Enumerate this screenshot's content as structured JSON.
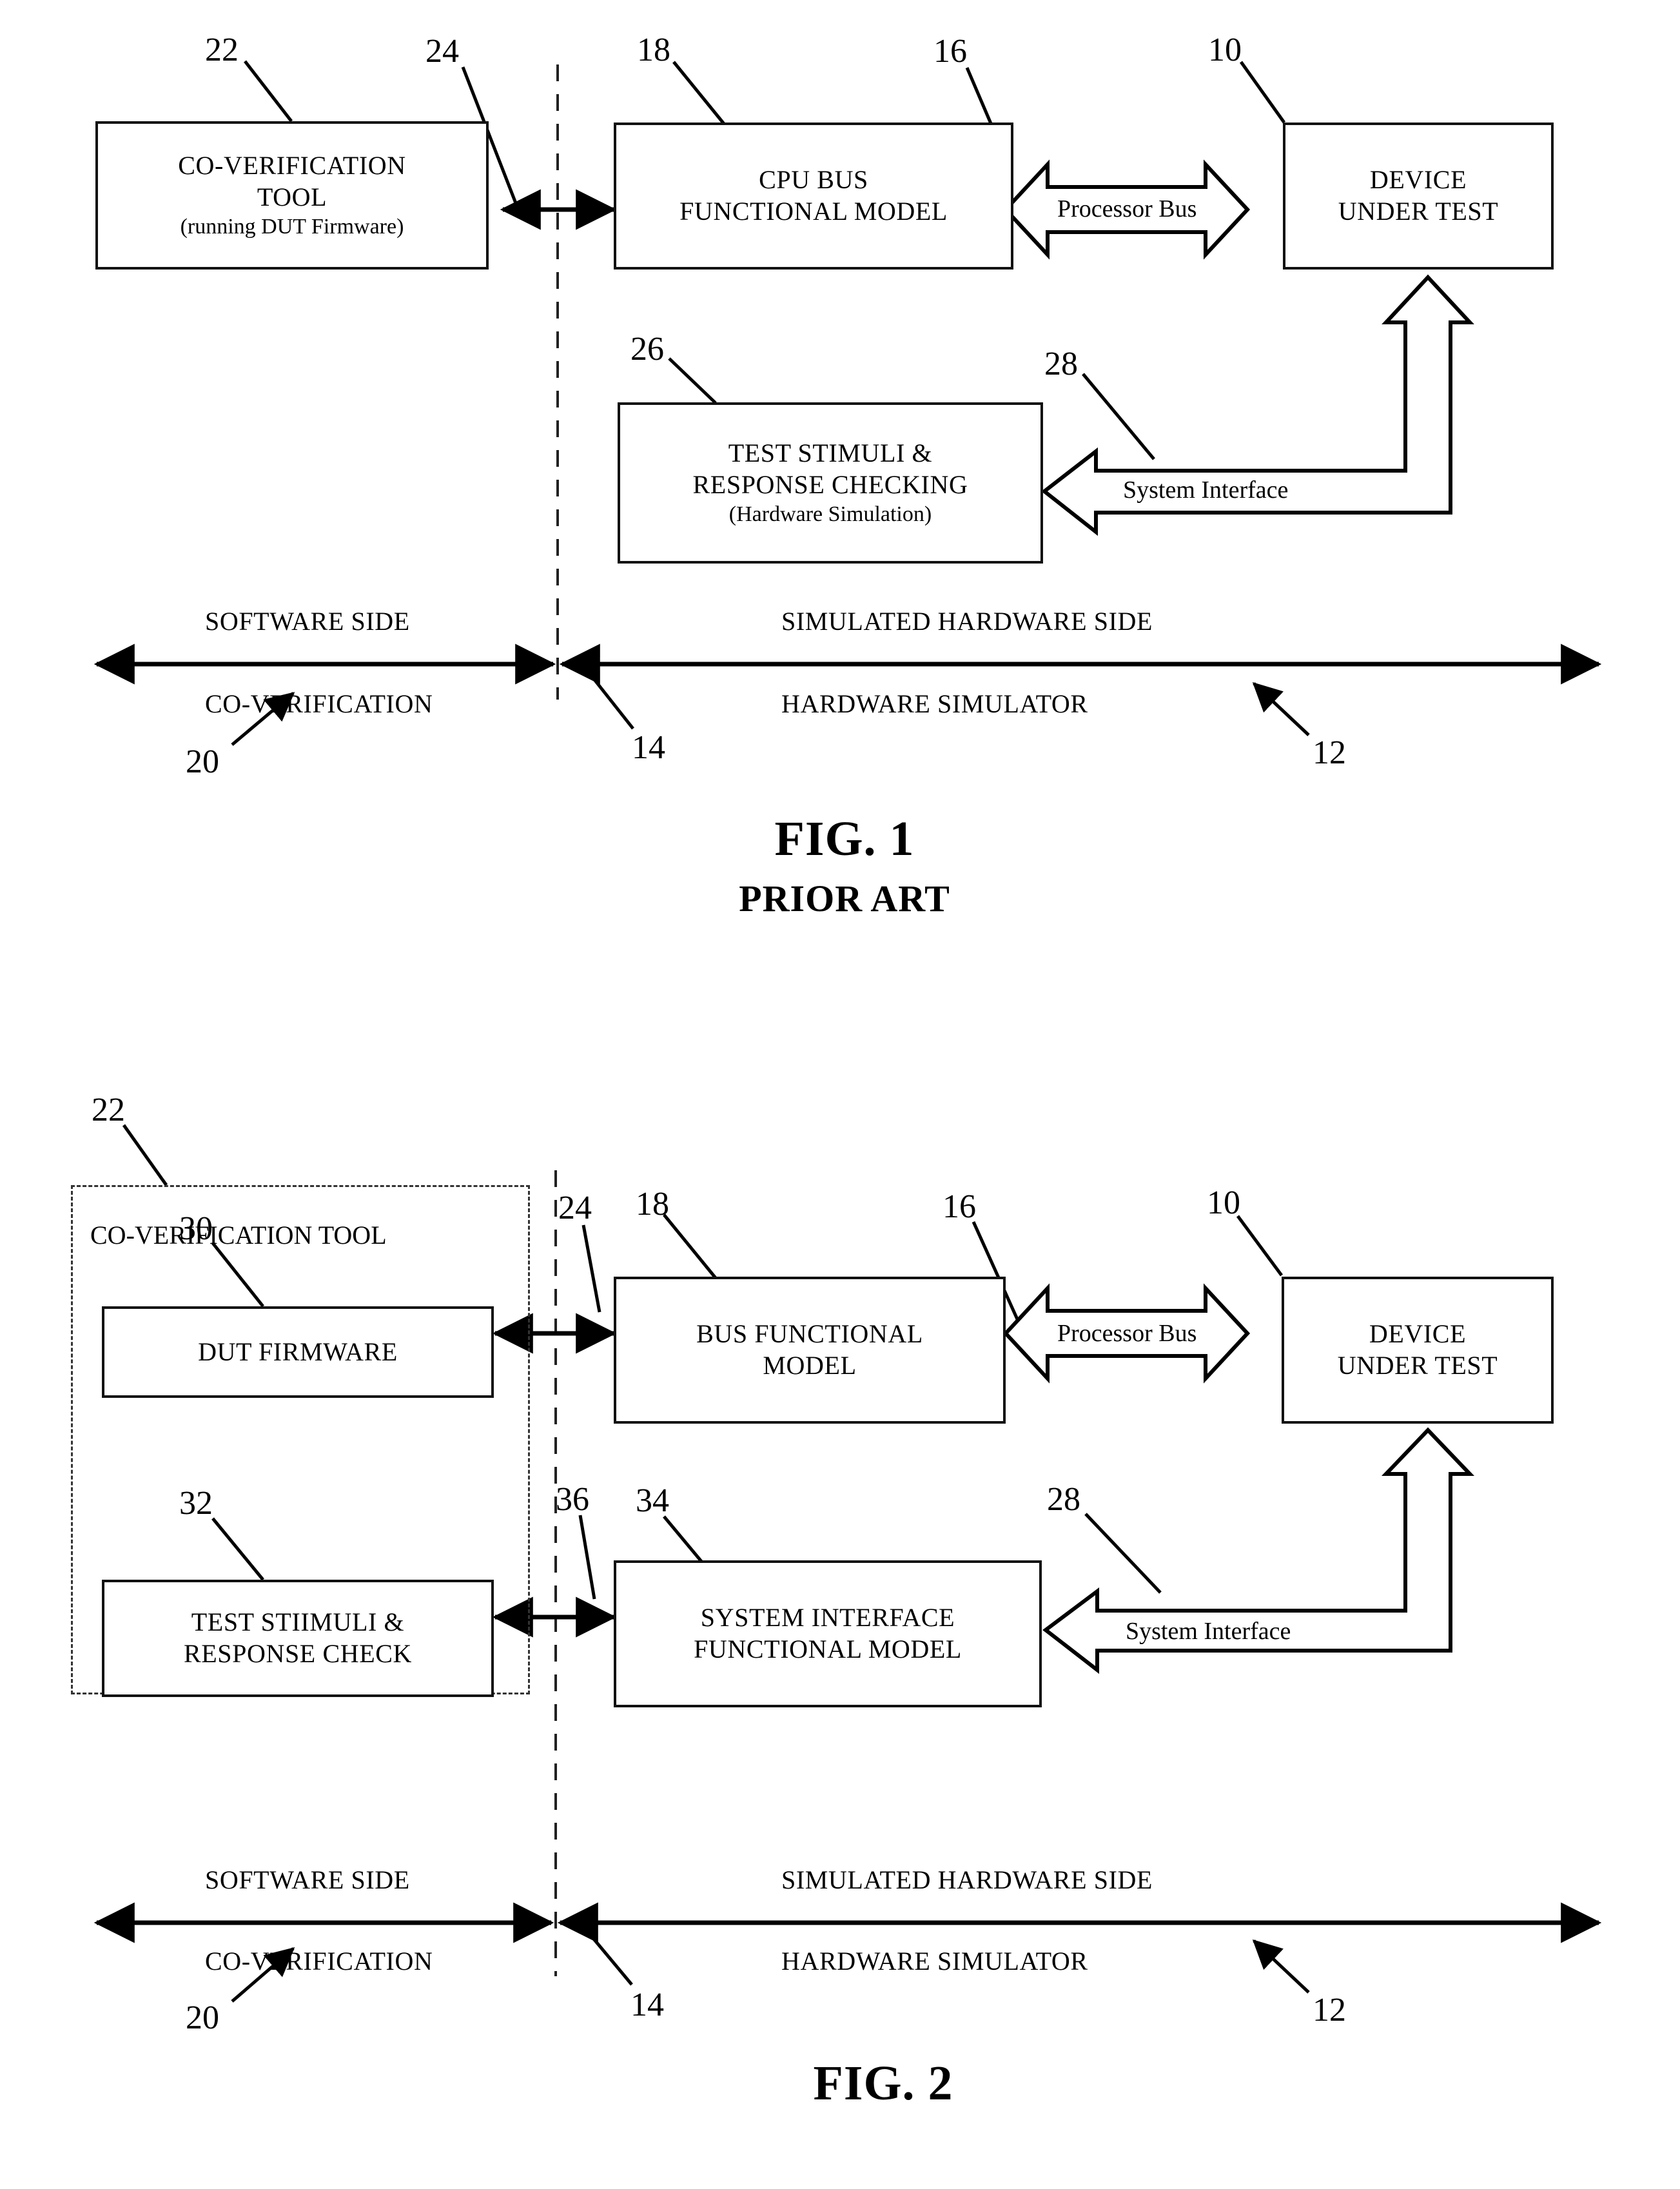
{
  "document": {
    "type": "patent-drawing-sheet",
    "figures": [
      {
        "id": "fig1",
        "caption": "FIG. 1",
        "subcaption": "PRIOR ART",
        "boxes": [
          {
            "ref": "22",
            "lines": [
              "CO-VERIFICATION",
              "TOOL"
            ],
            "sub": "(running DUT Firmware)"
          },
          {
            "ref": "18",
            "lines": [
              "CPU BUS",
              "FUNCTIONAL MODEL"
            ],
            "sub": ""
          },
          {
            "ref": "10",
            "lines": [
              "DEVICE",
              "UNDER TEST"
            ],
            "sub": ""
          },
          {
            "ref": "26",
            "lines": [
              "TEST STIMULI &",
              "RESPONSE CHECKING"
            ],
            "sub": "(Hardware Simulation)"
          }
        ],
        "connector_labels": [
          {
            "ref": "24",
            "text": ""
          },
          {
            "ref": "16",
            "text": "Processor Bus"
          },
          {
            "ref": "28",
            "text": "System Interface"
          }
        ],
        "axis": {
          "left_top": "SOFTWARE SIDE",
          "left_bottom": "CO-VERIFICATION",
          "right_top": "SIMULATED HARDWARE SIDE",
          "right_bottom": "HARDWARE SIMULATOR",
          "left_ref": "20",
          "center_ref": "14",
          "right_ref": "12"
        }
      },
      {
        "id": "fig2",
        "caption": "FIG. 2",
        "subcaption": "",
        "container": {
          "ref": "22",
          "title": "CO-VERIFICATION TOOL"
        },
        "boxes": [
          {
            "ref": "30",
            "lines": [
              "DUT FIRMWARE"
            ],
            "sub": ""
          },
          {
            "ref": "32",
            "lines": [
              "TEST STIIMULI &",
              "RESPONSE CHECK"
            ],
            "sub": ""
          },
          {
            "ref": "18",
            "lines": [
              "BUS FUNCTIONAL",
              "MODEL"
            ],
            "sub": ""
          },
          {
            "ref": "34",
            "lines": [
              "SYSTEM INTERFACE",
              "FUNCTIONAL MODEL"
            ],
            "sub": ""
          },
          {
            "ref": "10",
            "lines": [
              "DEVICE",
              "UNDER TEST"
            ],
            "sub": ""
          }
        ],
        "connector_labels": [
          {
            "ref": "24",
            "text": ""
          },
          {
            "ref": "36",
            "text": ""
          },
          {
            "ref": "16",
            "text": "Processor Bus"
          },
          {
            "ref": "28",
            "text": "System Interface"
          }
        ],
        "axis": {
          "left_top": "SOFTWARE SIDE",
          "left_bottom": "CO-VERIFICATION",
          "right_top": "SIMULATED HARDWARE SIDE",
          "right_bottom": "HARDWARE SIMULATOR",
          "left_ref": "20",
          "center_ref": "14",
          "right_ref": "12"
        }
      }
    ]
  },
  "colors": {
    "ink": "#000000",
    "paper": "#ffffff"
  }
}
